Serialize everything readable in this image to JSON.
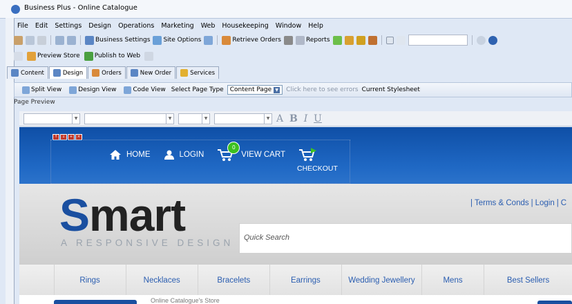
{
  "window": {
    "title": "Business Plus - Online Catalogue"
  },
  "menu": [
    "File",
    "Edit",
    "Settings",
    "Design",
    "Operations",
    "Marketing",
    "Web",
    "Housekeeping",
    "Window",
    "Help"
  ],
  "toolbar": {
    "business_settings": "Business Settings",
    "site_options": "Site Options",
    "retrieve_orders": "Retrieve Orders",
    "reports": "Reports"
  },
  "toolbar2": {
    "preview_store": "Preview Store",
    "publish_to_web": "Publish to Web"
  },
  "tabs": [
    {
      "label": "Content",
      "icon": "content-icon"
    },
    {
      "label": "Design",
      "icon": "design-icon"
    },
    {
      "label": "Orders",
      "icon": "orders-icon"
    },
    {
      "label": "New Order",
      "icon": "plus-icon"
    },
    {
      "label": "Services",
      "icon": "services-icon"
    }
  ],
  "designbar": {
    "split_view": "Split View",
    "design_view": "Design View",
    "code_view": "Code View",
    "select_page_type": "Select Page Type",
    "page_type_value": "Content Page",
    "errors_link": "Click here to see errors",
    "current_stylesheet": "Current Stylesheet"
  },
  "page_preview_label": "Page Preview",
  "format": {
    "letters": [
      "A",
      "B",
      "I",
      "U"
    ]
  },
  "store": {
    "nav": {
      "home": "HOME",
      "login": "LOGIN",
      "view_cart": "VIEW CART",
      "checkout": "CHECKOUT",
      "cart_count": "0"
    },
    "logo_s": "S",
    "logo_rest": "mart",
    "tagline": "A RESPONSIVE DESIGN",
    "search_placeholder": "Quick Search",
    "top_links": [
      "Terms & Conds",
      "Login"
    ],
    "categories": [
      "Rings",
      "Necklaces",
      "Bracelets",
      "Earrings",
      "Wedding Jewellery",
      "Mens",
      "Best Sellers"
    ],
    "bottom_text": "Online Catalogue's Store"
  },
  "colors": {
    "header_blue": "#1a5bb5",
    "logo_blue": "#1a4fa0",
    "link_blue": "#2a5db0",
    "cart_green": "#3cc020"
  }
}
